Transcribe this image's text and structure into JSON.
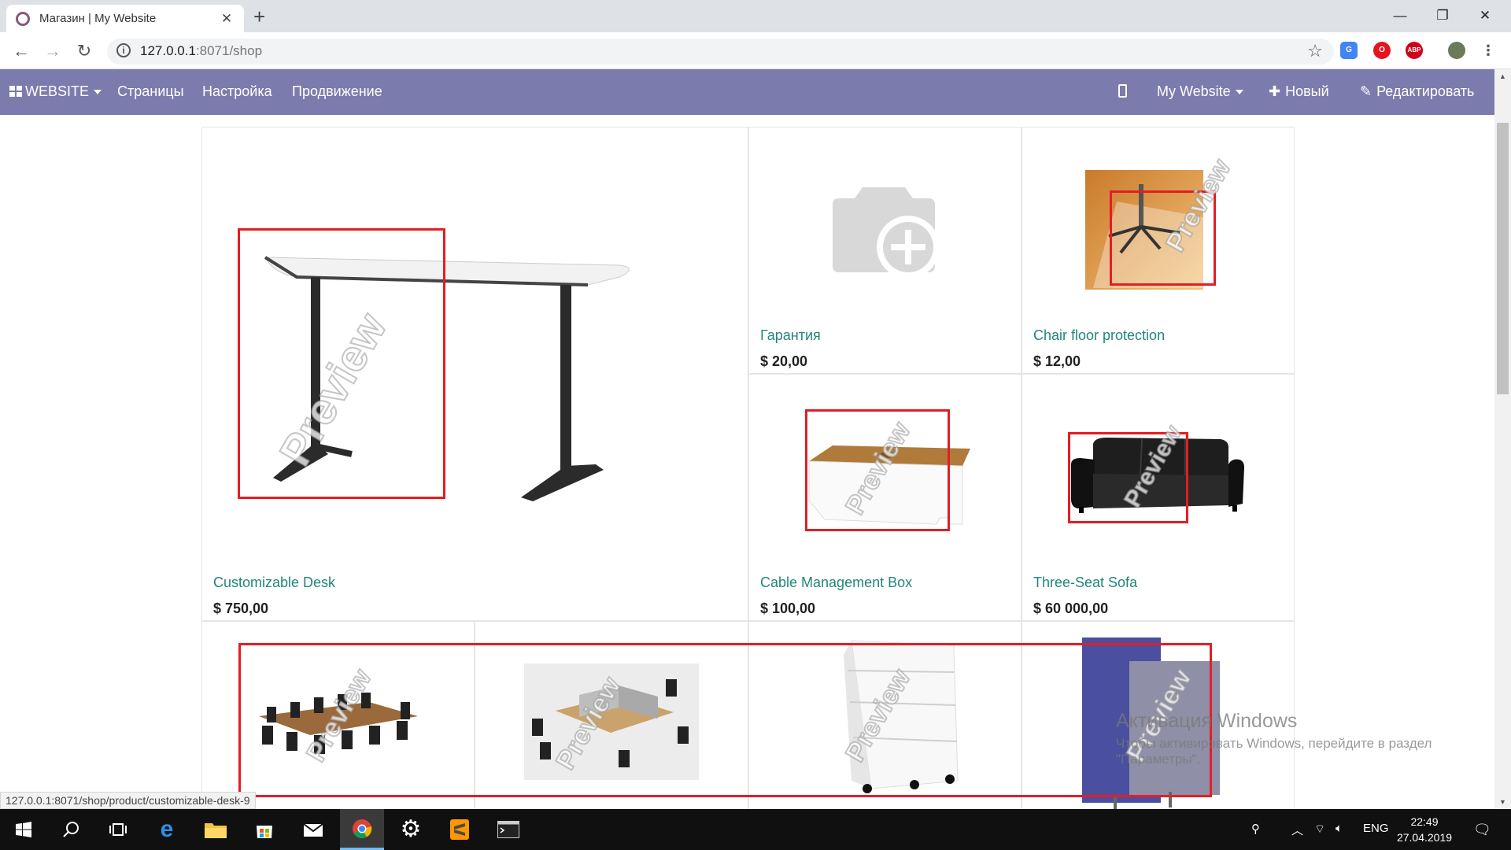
{
  "browser": {
    "tab_title": "Магазин | My Website",
    "tab_close": "✕",
    "new_tab": "+",
    "url_host": "127.0.0.1",
    "url_rest": ":8071/shop",
    "window_minimize": "—",
    "window_restore": "❐",
    "window_close": "✕",
    "back": "←",
    "forward": "→",
    "reload": "↻",
    "star": "☆",
    "extensions": [
      "G",
      "O",
      "ABP"
    ]
  },
  "odoo_nav": {
    "website_menu": "WEBSITE",
    "pages": "Страницы",
    "settings": "Настройка",
    "promote": "Продвижение",
    "site_switcher": "My Website",
    "new": "Новый",
    "edit": "Редактировать"
  },
  "products": [
    {
      "name": "Customizable Desk",
      "price": "$ 750,00"
    },
    {
      "name": "Гарантия",
      "price": "$ 20,00"
    },
    {
      "name": "Chair floor protection",
      "price": "$ 12,00"
    },
    {
      "name": "Cable Management Box",
      "price": "$ 100,00"
    },
    {
      "name": "Three-Seat Sofa",
      "price": "$ 60 000,00"
    }
  ],
  "watermark": "Preview",
  "status_url": "127.0.0.1:8071/shop/product/customizable-desk-9",
  "activation": {
    "title": "Активация Windows",
    "message": "Чтобы активировать Windows, перейдите в раздел \"Параметры\"."
  },
  "taskbar": {
    "language": "ENG",
    "time": "22:49",
    "date": "27.04.2019"
  },
  "colors": {
    "odoo_nav": "#7c7bad",
    "product_link": "#21867a",
    "annotation": "#e31e24"
  }
}
